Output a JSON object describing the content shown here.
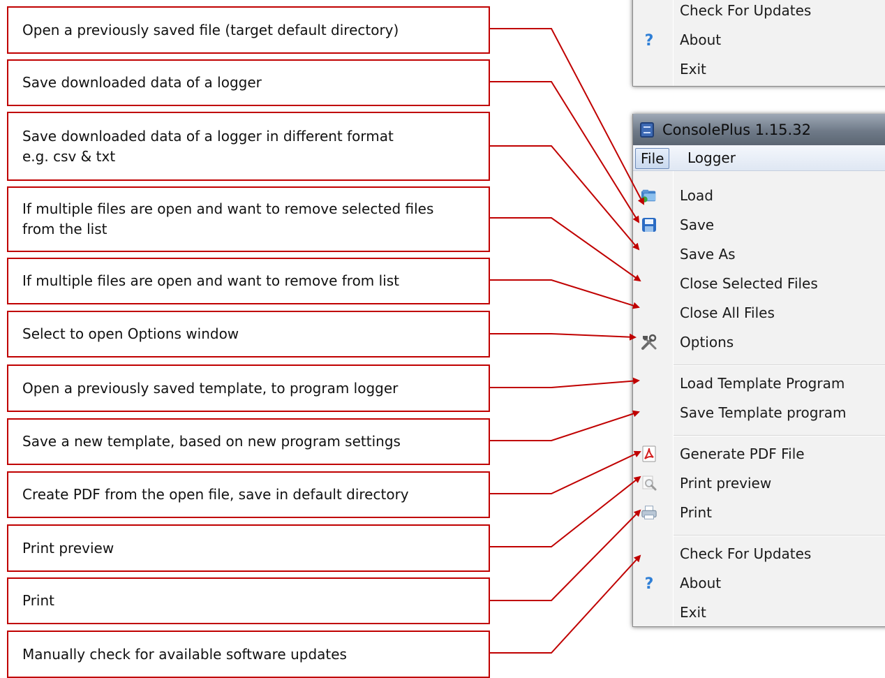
{
  "callouts": [
    "Open a previously saved file (target default directory)",
    "Save downloaded data of a logger",
    "Save downloaded data of a logger in different format\ne.g. csv & txt",
    "If multiple files are open and want to remove selected files\nfrom the list",
    "If multiple files are open and want to remove from list",
    "Select to open Options window",
    "Open a previously saved template, to program logger",
    "Save a new template, based on new program settings",
    "Create PDF from the open file, save in default directory",
    "Print preview",
    "Print",
    "Manually check for available software updates"
  ],
  "top_menu": {
    "items": [
      "Check For Updates",
      "About",
      "Exit"
    ]
  },
  "window": {
    "title": "ConsolePlus 1.15.32",
    "menubar": [
      "File",
      "Logger"
    ]
  },
  "file_menu": {
    "items": [
      {
        "label": "Load",
        "icon": "folder-open-icon"
      },
      {
        "label": "Save",
        "icon": "floppy-disk-icon"
      },
      {
        "label": "Save As",
        "icon": ""
      },
      {
        "label": "Close Selected Files",
        "icon": ""
      },
      {
        "label": "Close All Files",
        "icon": ""
      },
      {
        "label": "Options",
        "icon": "tools-icon"
      },
      {
        "label": "Load Template Program",
        "icon": ""
      },
      {
        "label": "Save Template program",
        "icon": ""
      },
      {
        "label": "Generate PDF File",
        "icon": "pdf-icon"
      },
      {
        "label": "Print preview",
        "icon": "print-preview-icon"
      },
      {
        "label": "Print",
        "icon": "printer-icon"
      },
      {
        "label": "Check For Updates",
        "icon": ""
      },
      {
        "label": "About",
        "icon": "help-icon"
      },
      {
        "label": "Exit",
        "icon": ""
      }
    ]
  },
  "colors": {
    "callout_border": "#c00000",
    "arrow": "#c00000",
    "menu_bg": "#f2f2f2",
    "titlebar": "#6f7a88"
  }
}
